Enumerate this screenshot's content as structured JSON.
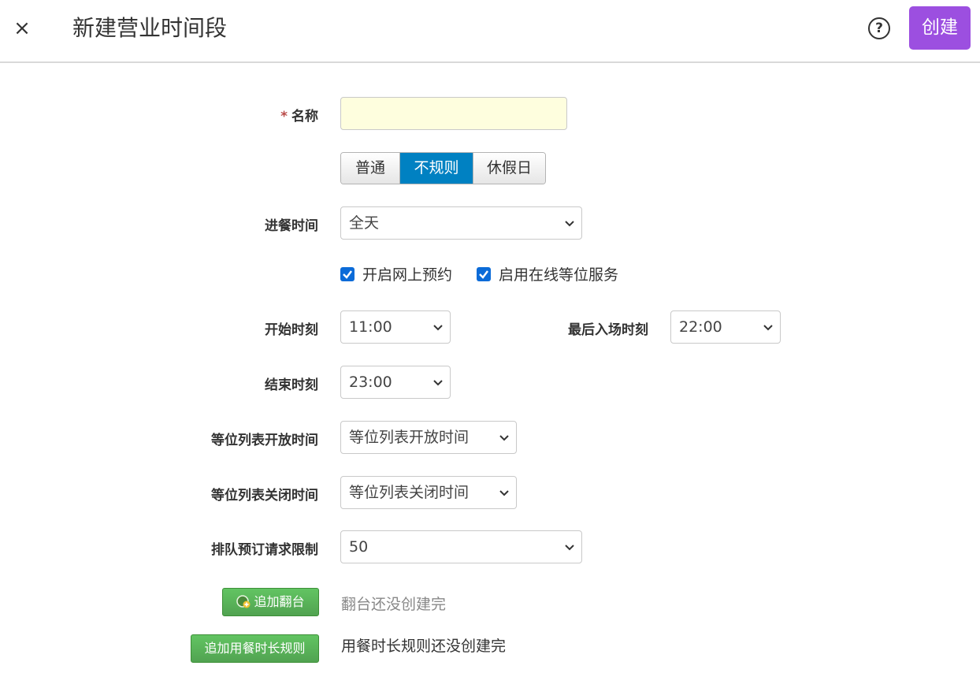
{
  "header": {
    "title": "新建营业时间段",
    "create_label": "创建",
    "close_icon": "×",
    "help_icon": "?"
  },
  "form": {
    "name": {
      "required_mark": "*",
      "label": "名称",
      "value": ""
    },
    "type_options": [
      "普通",
      "不规则",
      "休假日"
    ],
    "type_selected": "不规则",
    "meal_time": {
      "label": "进餐时间",
      "value": "全天"
    },
    "online_booking": {
      "label": "开启网上预约",
      "checked": true
    },
    "online_waitlist": {
      "label": "启用在线等位服务",
      "checked": true
    },
    "start_time": {
      "label": "开始时刻",
      "value": "11:00"
    },
    "last_entry": {
      "label": "最后入场时刻",
      "value": "22:00"
    },
    "end_time": {
      "label": "结束时刻",
      "value": "23:00"
    },
    "waitlist_open": {
      "label": "等位列表开放时间",
      "placeholder": "等位列表开放时间"
    },
    "waitlist_close": {
      "label": "等位列表关闭时间",
      "placeholder": "等位列表关闭时间"
    },
    "queue_limit": {
      "label": "排队预订请求限制",
      "value": "50"
    },
    "add_turnover": {
      "button": "追加翻台",
      "note": "翻台还没创建完"
    },
    "add_dining_rule": {
      "button": "追加用餐时长规则",
      "note": "用餐时长规则还没创建完"
    }
  },
  "colors": {
    "accent": "#9c4fe0",
    "segment_active": "#0081c2",
    "name_input_bg": "#fefede",
    "checkbox": "#0b6bd8",
    "green_button": "#51a351",
    "required": "#b94a48"
  }
}
